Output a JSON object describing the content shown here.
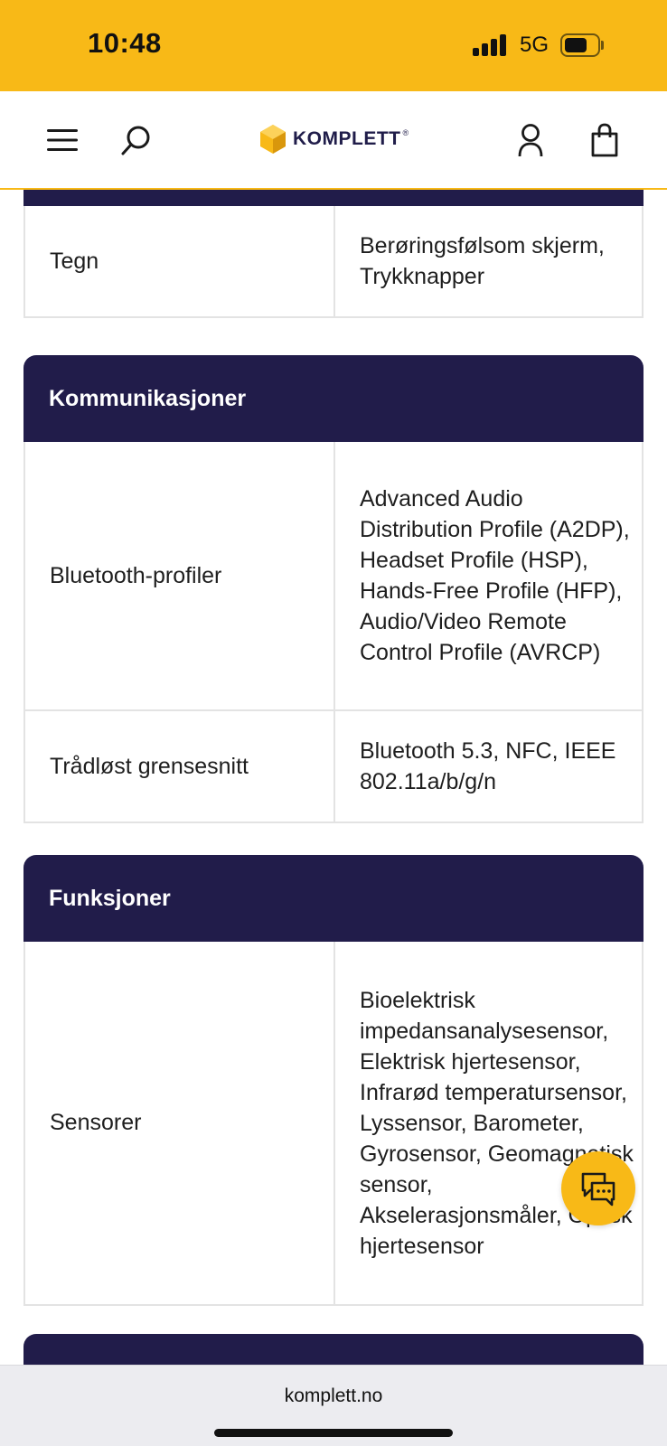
{
  "status_bar": {
    "time": "10:48",
    "network": "5G",
    "signal_icon": "signal-bars-icon",
    "battery_icon": "battery-icon",
    "battery_level": 0.6
  },
  "header": {
    "menu_icon": "hamburger-menu-icon",
    "search_icon": "search-icon",
    "logo_text": "KOMPLETT",
    "logo_mark": "®",
    "account_icon": "user-icon",
    "cart_icon": "shopping-bag-icon"
  },
  "colors": {
    "brand_yellow": "#f8b917",
    "brand_navy": "#211c4a",
    "border": "#e3e3e3"
  },
  "spec_sections": [
    {
      "title": "",
      "rows": [
        {
          "label": "Tegn",
          "value": "Berøringsfølsom skjerm, Trykknapper"
        }
      ]
    },
    {
      "title": "Kommunikasjoner",
      "rows": [
        {
          "label": "Bluetooth-profiler",
          "value": "Advanced Audio Distribution Profile (A2DP), Headset Profile (HSP), Hands-Free Profile (HFP), Audio/Video Remote Control Profile (AVRCP)"
        },
        {
          "label": "Trådløst grensesnitt",
          "value": "Bluetooth 5.3, NFC, IEEE 802.11a/b/g/n"
        }
      ]
    },
    {
      "title": "Funksjoner",
      "rows": [
        {
          "label": "Sensorer",
          "value": "Bioelektrisk impedansanalysesensor, Elektrisk hjertesensor, Infrarød temperatursensor, Lyssensor, Barometer, Gyrosensor, Geomagnetisk sensor, Akselerasjonsmåler, Optisk hjertesensor"
        }
      ]
    }
  ],
  "chat_button": {
    "icon": "chat-bubbles-icon"
  },
  "browser": {
    "url": "komplett.no"
  }
}
